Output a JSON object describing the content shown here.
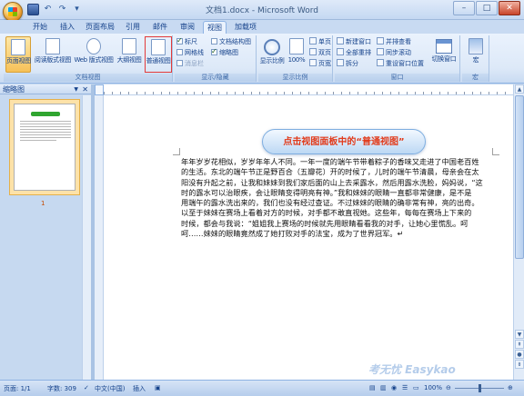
{
  "window": {
    "title": "文档1.docx - Microsoft Word",
    "controls": {
      "minimize": "–",
      "maximize": "□",
      "close": "✕"
    }
  },
  "quick_access": {
    "undo": "↶",
    "redo": "↷",
    "more": "▾"
  },
  "tabs": [
    {
      "label": "开始",
      "active": false
    },
    {
      "label": "插入",
      "active": false
    },
    {
      "label": "页面布局",
      "active": false
    },
    {
      "label": "引用",
      "active": false
    },
    {
      "label": "邮件",
      "active": false
    },
    {
      "label": "审阅",
      "active": false
    },
    {
      "label": "视图",
      "active": true
    },
    {
      "label": "加载项",
      "active": false
    }
  ],
  "ribbon": {
    "views": {
      "label": "文档视图",
      "buttons": [
        "页面视图",
        "阅读版式视图",
        "Web 版式视图",
        "大纲视图",
        "普通视图"
      ],
      "active": "页面视图",
      "highlighted": "普通视图"
    },
    "show_hide": {
      "label": "显示/隐藏",
      "items": [
        {
          "label": "标尺",
          "checked": true
        },
        {
          "label": "文档结构图",
          "checked": false
        },
        {
          "label": "网格线",
          "checked": false
        },
        {
          "label": "缩略图",
          "checked": true
        },
        {
          "label": "消息栏",
          "checked": false
        }
      ]
    },
    "zoom": {
      "label": "显示比例",
      "zoom_button": "显示比例",
      "percent_button": "100%",
      "small": [
        "单页",
        "双页",
        "页宽"
      ]
    },
    "window": {
      "label": "窗口",
      "items": [
        "新建窗口",
        "全部重排",
        "拆分",
        "并排查看",
        "同步滚动",
        "重设窗口位置"
      ],
      "switch_button": "切换窗口"
    },
    "macros": {
      "label": "宏",
      "button": "宏"
    }
  },
  "nav_pane": {
    "title": "缩略图",
    "page_number": "1"
  },
  "callout": "点击视图面板中的“普通视图”",
  "document": {
    "lines": [
      "年年岁岁花相似，岁岁年年人不同。一年一度的端午节带着粽子的香味又走进了中国老百姓",
      "的生活。东北的端午节正是野百合（五瓣花）开的时候了，儿时的端午节清晨，母亲会在太",
      "阳没有升起之前，让我和妹妹到我们家后面的山上去采露水，然后用露水洗脸，妈妈说，“这",
      "时的露水可以治眼疾，会让眼睛变得明亮有神。”我和妹妹的眼睛一直都非常健康，是不是",
      "用端午的露水洗出来的，我们也没有经过查证。不过妹妹的眼睛的确非常有神，亮的出奇。",
      "以至于妹妹在赛场上看着对方的时候，对手都不敢直视她。这些年，每每在赛场上下来的",
      "时候，都会与我说：“姐姐我上赛场的时候就先用眼睛看看我的对手，让她心里慌乱。呵",
      "呵……妹妹的眼睛竟然成了她打败对手的法宝，成为了世界冠军。↵"
    ]
  },
  "status_bar": {
    "page": "页面: 1/1",
    "words": "字数: 309",
    "language": "中文(中国)",
    "mode": "插入",
    "zoom": "100%"
  },
  "watermark": "考无忧 Easykao",
  "colors": {
    "accent": "#15428b",
    "callout_text": "#e23a1a",
    "highlight_border": "#e23a3a"
  }
}
